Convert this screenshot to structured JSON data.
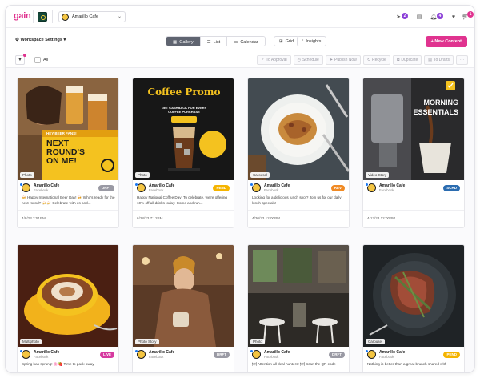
{
  "app": {
    "logo": "gain",
    "account": "Amarillo Cafe",
    "notifications": {
      "messages": "2",
      "alerts": "4",
      "cart": "1"
    }
  },
  "toolbar": {
    "workspace": "Workspace Settings",
    "views": [
      "Gallery",
      "List",
      "Calendar"
    ],
    "active_view": "Gallery",
    "grid_label": "Grid",
    "insights_label": "Insights",
    "new_content": "+ New Content"
  },
  "filterbar": {
    "all_label": "All",
    "actions": [
      "To Approval",
      "Schedule",
      "Publish Now",
      "Recycle",
      "Duplicate",
      "To Drafts"
    ]
  },
  "colors": {
    "brand": "#e0338f",
    "draft": "#9a9aa4",
    "pend": "#f5b400",
    "rev": "#f08a24",
    "schd": "#2b6cb0",
    "live": "#d63aa0"
  },
  "posts": [
    {
      "tag": "Photo",
      "name": "Amarillo Cafe",
      "platform": "Facebook",
      "status": "DRFT",
      "status_color": "#9a9aa4",
      "caption": "🍻 Happy International Beer Day! 🍻 Who's ready for the next round? 🍻🍻 Celebrate with us and...",
      "date": "4/8/23 2:51PM",
      "overlay": "NEXT ROUND'S ON ME!",
      "overlay_small": "HEY BEER FANS!"
    },
    {
      "tag": "Photo",
      "name": "Amarillo Cafe",
      "platform": "Facebook",
      "status": "PEND",
      "status_color": "#f5b400",
      "caption": "Happy National Coffee Day! To celebrate, we're offering 10% off all drinks today. Come and run...",
      "date": "6/28/23 7:12PM",
      "overlay": "Coffee Promo",
      "overlay_small": "GET CASHBACK FOR EVERY COFFEE PURCHASE"
    },
    {
      "tag": "Carousel",
      "name": "Amarillo Cafe",
      "platform": "Facebook",
      "status": "REV",
      "status_color": "#f08a24",
      "caption": "Looking for a delicious lunch spot? Join us for our daily lunch specials!",
      "date": "4/30/23 12:00PM"
    },
    {
      "tag": "Video Story",
      "name": "Amarillo Cafe",
      "platform": "Facebook",
      "status": "SCHD",
      "status_color": "#2b6cb0",
      "caption": "",
      "date": "4/13/23 12:00PM",
      "overlay": "MORNING ESSENTIALS"
    },
    {
      "tag": "Multiphoto",
      "name": "Amarillo Cafe",
      "platform": "Facebook",
      "status": "LIVE",
      "status_color": "#d63aa0",
      "caption": "Spring has sprung! 🌸🍓 Time to pack away",
      "date": ""
    },
    {
      "tag": "Photo Story",
      "name": "Amarillo Cafe",
      "platform": "Facebook",
      "status": "DRFT",
      "status_color": "#9a9aa4",
      "caption": "",
      "date": ""
    },
    {
      "tag": "Photo",
      "name": "Amarillo Cafe",
      "platform": "Facebook",
      "status": "DRFT",
      "status_color": "#9a9aa4",
      "caption": "🍽 Attention all deal hunters! 🍽 Scan the QR code",
      "date": ""
    },
    {
      "tag": "Carousel",
      "name": "Amarillo Cafe",
      "platform": "Facebook",
      "status": "PEND",
      "status_color": "#f5b400",
      "caption": "Nothing is better than a great brunch shared with",
      "date": ""
    }
  ]
}
